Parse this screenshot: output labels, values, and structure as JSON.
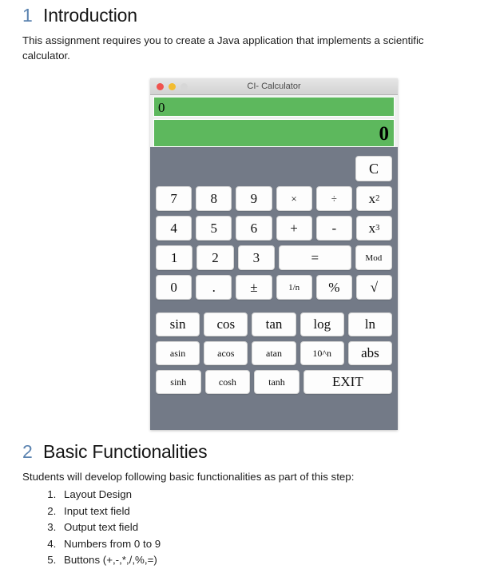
{
  "document": {
    "sections": [
      {
        "number": "1",
        "title": "Introduction",
        "paragraph": "This assignment requires you to create a Java application that implements a scientific calculator."
      },
      {
        "number": "2",
        "title": "Basic Functionalities",
        "paragraph": "Students will develop following basic functionalities as part of this step:",
        "list": [
          "Layout Design",
          "Input text field",
          "Output text field",
          "Numbers from 0 to 9",
          "Buttons (+,-,*,/,%,=)"
        ]
      }
    ]
  },
  "calculator": {
    "title": "CI- Calculator",
    "window_controls": {
      "close": "close-button",
      "minimize": "minimize-button",
      "maximize": "maximize-button-disabled"
    },
    "display": {
      "input_value": "0",
      "output_value": "0"
    },
    "keypad": {
      "clear_label": "C",
      "rows": [
        [
          "7",
          "8",
          "9",
          "×",
          "÷",
          "x2"
        ],
        [
          "4",
          "5",
          "6",
          "+",
          "-",
          "x3"
        ],
        [
          "1",
          "2",
          "3",
          "=",
          "Mod"
        ],
        [
          "0",
          ".",
          "±",
          "1/n",
          "%",
          "√"
        ]
      ],
      "row1": {
        "k1": "7",
        "k2": "8",
        "k3": "9",
        "k4": "×",
        "k5": "÷",
        "k6_base": "x",
        "k6_sup": "2"
      },
      "row2": {
        "k1": "4",
        "k2": "5",
        "k3": "6",
        "k4": "+",
        "k5": "-",
        "k6_base": "x",
        "k6_sup": "3"
      },
      "row3": {
        "k1": "1",
        "k2": "2",
        "k3": "3",
        "k4": "=",
        "k5": "Mod"
      },
      "row4": {
        "k1": "0",
        "k2": ".",
        "k3": "±",
        "k4": "1/n",
        "k5": "%",
        "k6": "√"
      }
    },
    "scientific": {
      "row1": {
        "k1": "sin",
        "k2": "cos",
        "k3": "tan",
        "k4": "log",
        "k5": "ln"
      },
      "row2": {
        "k1": "asin",
        "k2": "acos",
        "k3": "atan",
        "k4": "10^n",
        "k5": "abs"
      },
      "row3": {
        "k1": "sinh",
        "k2": "cosh",
        "k3": "tanh",
        "k4": "EXIT"
      }
    }
  },
  "colors": {
    "display_green": "#5db85d",
    "body_gray": "#737a87",
    "heading_blue": "#5b83b0",
    "button_white": "#fdfdfd"
  }
}
